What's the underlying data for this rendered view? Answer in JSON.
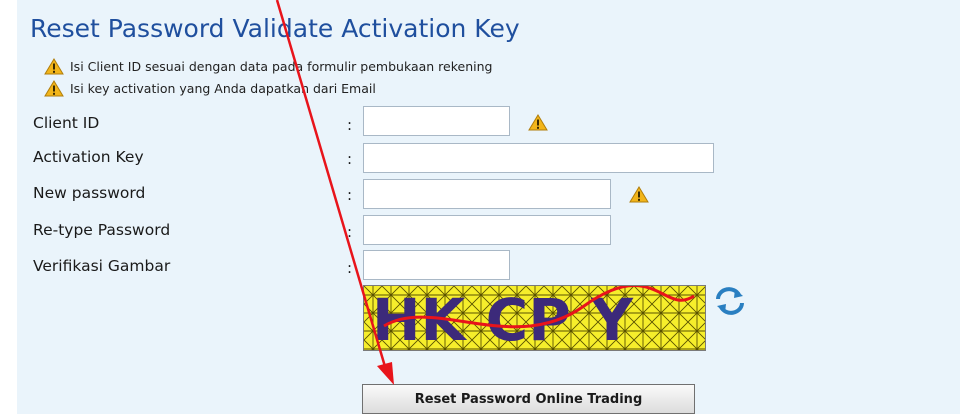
{
  "page": {
    "title": "Reset Password Validate Activation Key"
  },
  "notes": [
    {
      "text": "Isi Client ID sesuai dengan data pada formulir pembukaan rekening",
      "icon": "warning-icon"
    },
    {
      "text": "Isi key activation yang Anda dapatkan dari Email",
      "icon": "warning-icon"
    }
  ],
  "form": {
    "colon": ":",
    "client_id": {
      "label": "Client ID",
      "value": "",
      "icon": "warning-icon"
    },
    "activation_key": {
      "label": "Activation Key",
      "value": ""
    },
    "new_password": {
      "label": "New password",
      "value": "",
      "icon": "warning-icon"
    },
    "retype_password": {
      "label": "Re-type Password",
      "value": ""
    },
    "verification": {
      "label": "Verifikasi Gambar",
      "value": ""
    }
  },
  "captcha": {
    "text": "HK CP Y",
    "refresh_icon": "refresh-icon"
  },
  "submit": {
    "label": "Reset Password Online Trading"
  },
  "annotation": {
    "type": "red-arrow",
    "color": "#e8141b"
  },
  "colors": {
    "panel_bg": "#eaf4fb",
    "title": "#1f4f9e",
    "warning": "#f2b51a",
    "captcha_bg": "#f6ee2b"
  }
}
